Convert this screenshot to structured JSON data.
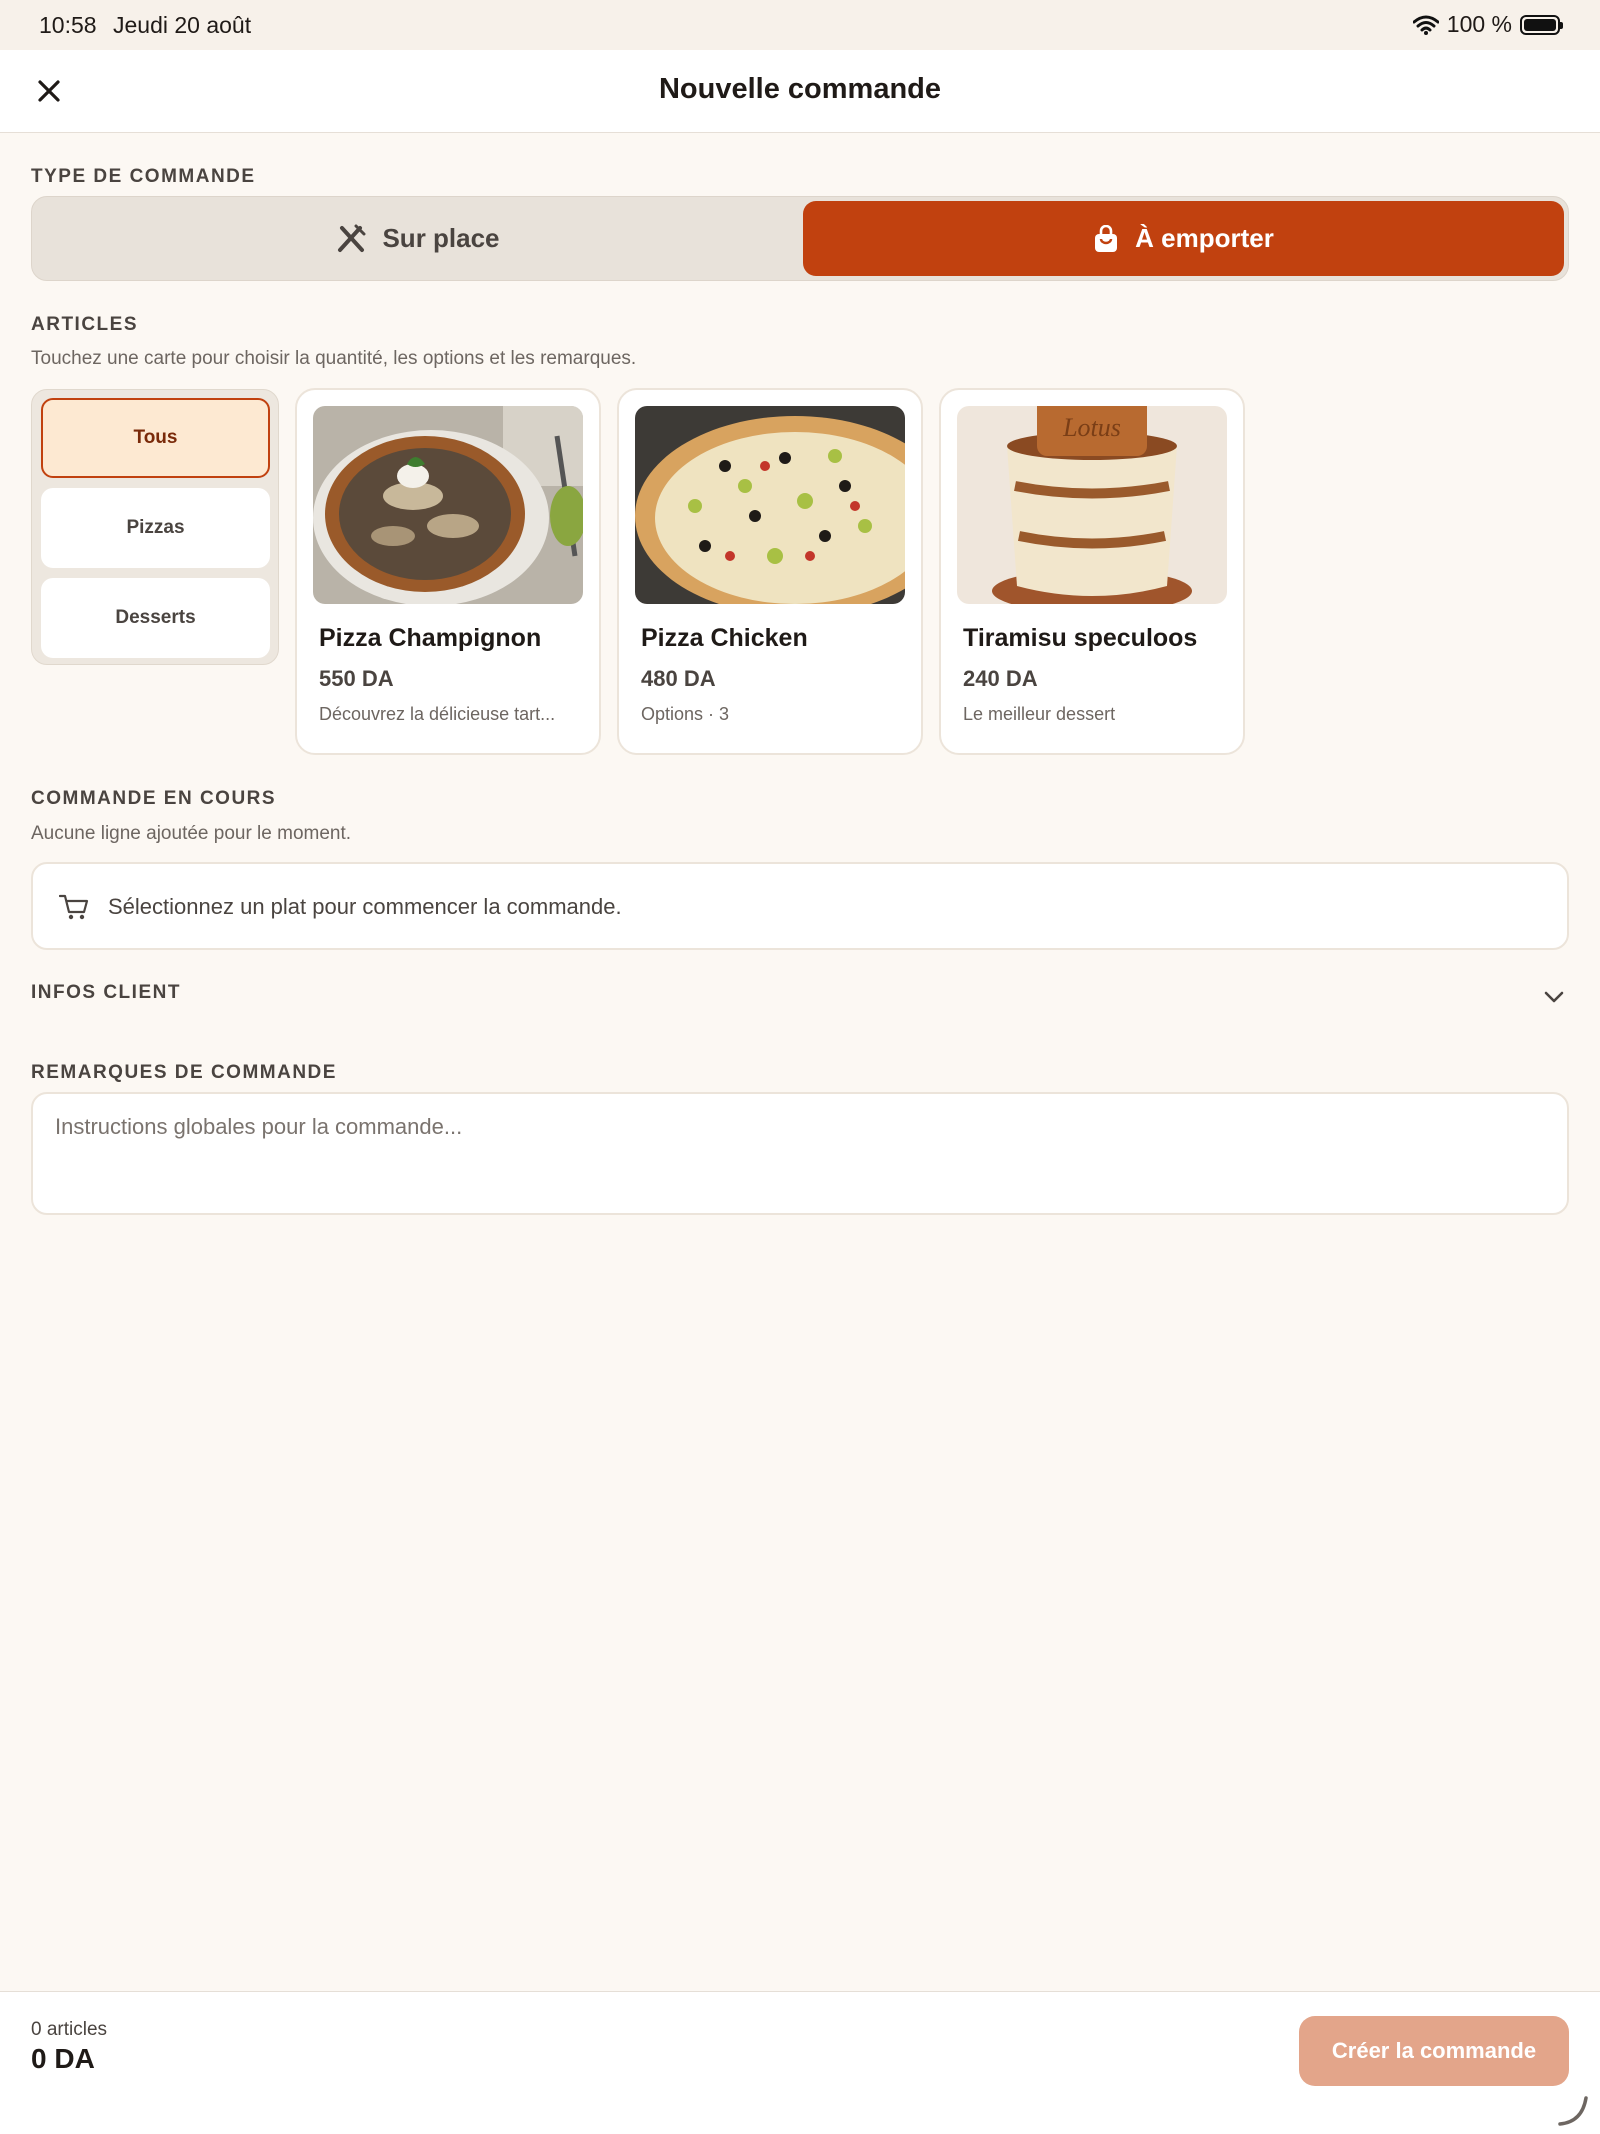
{
  "status_bar": {
    "time": "10:58",
    "date": "Jeudi 20 août",
    "battery": "100 %",
    "wifi_icon": "wifi-icon",
    "battery_icon": "battery-icon"
  },
  "header": {
    "title": "Nouvelle commande",
    "close_icon": "close-icon"
  },
  "order_type": {
    "label": "TYPE DE COMMANDE",
    "options": [
      {
        "label": "Sur place",
        "icon": "utensils-icon",
        "selected": false
      },
      {
        "label": "À emporter",
        "icon": "shopping-bag-icon",
        "selected": true
      }
    ]
  },
  "articles": {
    "label": "ARTICLES",
    "hint": "Touchez une carte pour choisir la quantité, les options et les remarques.",
    "categories": [
      {
        "label": "Tous",
        "selected": true
      },
      {
        "label": "Pizzas",
        "selected": false
      },
      {
        "label": "Desserts",
        "selected": false
      }
    ],
    "products": [
      {
        "name": "Pizza Champignon",
        "price": "550 DA",
        "desc": "Découvrez la délicieuse tart..."
      },
      {
        "name": "Pizza Chicken",
        "price": "480 DA",
        "desc": "Options · 3"
      },
      {
        "name": "Tiramisu speculoos",
        "price": "240 DA",
        "desc": "Le meilleur dessert"
      }
    ]
  },
  "current_order": {
    "label": "COMMANDE EN COURS",
    "hint": "Aucune ligne ajoutée pour le moment.",
    "empty_message": "Sélectionnez un plat pour commencer la commande.",
    "cart_icon": "cart-icon"
  },
  "client_info": {
    "label": "INFOS CLIENT",
    "chevron_icon": "chevron-down-icon"
  },
  "remarks": {
    "label": "REMARQUES DE COMMANDE",
    "placeholder": "Instructions globales pour la commande..."
  },
  "footer": {
    "count": "0 articles",
    "total": "0 DA",
    "create_label": "Créer la commande"
  },
  "colors": {
    "accent": "#c1410f",
    "background": "#fcf8f3",
    "disabled_button": "#e3a58a",
    "category_active_bg": "#fde9d2"
  }
}
